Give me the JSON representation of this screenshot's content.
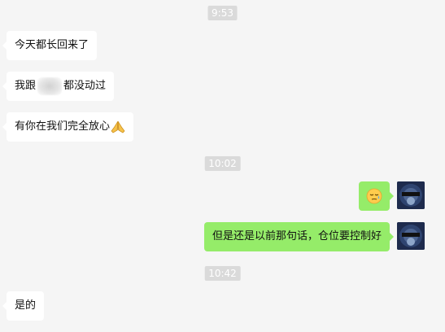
{
  "timestamps": [
    "9:53",
    "10:02",
    "10:42"
  ],
  "messages": [
    {
      "side": "in",
      "text": "今天都长回来了"
    },
    {
      "side": "in",
      "text_before": "我跟",
      "text_after": "都没动过"
    },
    {
      "side": "in",
      "text": "有你在我们完全放心",
      "emoji": "praying-hands"
    },
    {
      "side": "out",
      "emoji": "sleepy-face"
    },
    {
      "side": "out",
      "text": "但是还是以前那句话，仓位要控制好"
    },
    {
      "side": "in",
      "text": "是的"
    }
  ],
  "colors": {
    "background": "#f5f5f5",
    "incoming_bubble": "#ffffff",
    "outgoing_bubble": "#95ec69",
    "timestamp_bg": "#dadada"
  },
  "icons": {
    "avatar": "user-avatar",
    "redaction": "blurred-redaction"
  }
}
